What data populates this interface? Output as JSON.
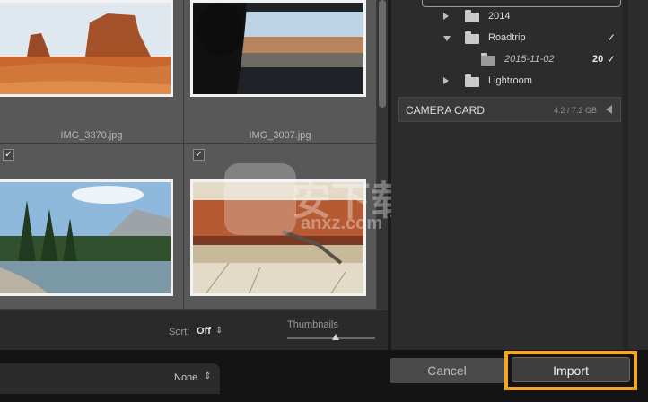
{
  "grid": {
    "cells": [
      {
        "filename": "IMG_3370.jpg",
        "checked": false
      },
      {
        "filename": "IMG_3007.jpg",
        "checked": false
      },
      {
        "filename": "",
        "checked": true
      },
      {
        "filename": "",
        "checked": true
      }
    ],
    "check_glyph": "✓"
  },
  "toolbar": {
    "sort_label": "Sort:",
    "sort_value": "Off",
    "sort_arrows": "⇕",
    "thumbnails_label": "Thumbnails",
    "thumbnail_size": 0.55
  },
  "panel": {
    "folders": [
      {
        "name": "2014",
        "expanded": false,
        "count": "",
        "checked": false
      },
      {
        "name": "Roadtrip",
        "expanded": true,
        "count": "",
        "checked": true
      },
      {
        "name": "2015-11-02",
        "expanded": false,
        "count": "20",
        "checked": true
      },
      {
        "name": "Lightroom",
        "expanded": false,
        "count": "",
        "checked": false
      }
    ],
    "camera_card": {
      "label": "CAMERA CARD",
      "size": "4.2 / 7.2 GB"
    }
  },
  "bottom": {
    "preset_value": "None",
    "preset_arrows": "⇕",
    "cancel_label": "Cancel",
    "import_label": "Import",
    "import_highlight_color": "#f5a623"
  },
  "watermark": {
    "text": "安下载",
    "sub": "anxz.com"
  }
}
